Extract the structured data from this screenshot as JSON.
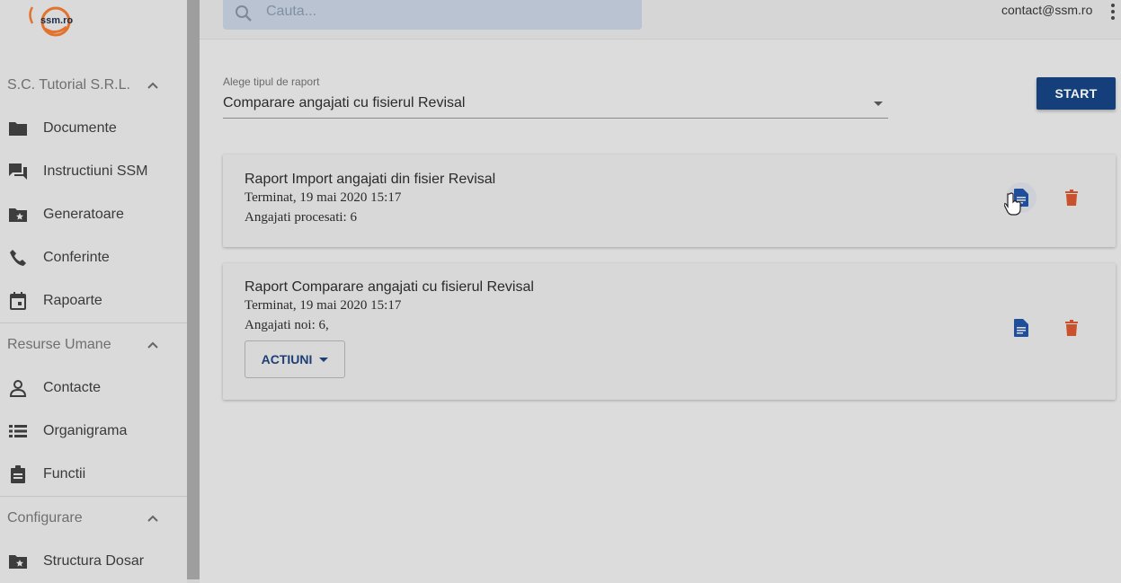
{
  "app": {
    "logo_text": "ssm.ro",
    "brand_color": "#e2722c",
    "accent_color": "#153f7a",
    "delete_color": "#c9522c"
  },
  "sidebar": {
    "sections": [
      {
        "header": "S.C. Tutorial S.R.L.",
        "expanded": true,
        "items": [
          {
            "label": "Documente",
            "icon": "folder-icon"
          },
          {
            "label": "Instructiuni SSM",
            "icon": "forum-icon"
          },
          {
            "label": "Generatoare",
            "icon": "folder-star-icon"
          },
          {
            "label": "Conferinte",
            "icon": "phone-icon"
          },
          {
            "label": "Rapoarte",
            "icon": "calendar-icon"
          }
        ]
      },
      {
        "header": "Resurse Umane",
        "expanded": true,
        "items": [
          {
            "label": "Contacte",
            "icon": "person-icon"
          },
          {
            "label": "Organigrama",
            "icon": "list-icon"
          },
          {
            "label": "Functii",
            "icon": "clipboard-icon"
          }
        ]
      },
      {
        "header": "Configurare",
        "expanded": true,
        "items": [
          {
            "label": "Structura Dosar",
            "icon": "folder-star-icon"
          }
        ]
      }
    ]
  },
  "topbar": {
    "search_placeholder": "Cauta...",
    "user_email": "contact@ssm.ro"
  },
  "report_form": {
    "label": "Alege tipul de raport",
    "selected": "Comparare angajati cu fisierul Revisal",
    "start_label": "START"
  },
  "reports": [
    {
      "title": "Raport Import angajati din fisier Revisal",
      "status": "Terminat, 19 mai 2020 15:17",
      "detail": "Angajati procesati: 6"
    },
    {
      "title": "Raport Comparare angajati cu fisierul Revisal",
      "status": "Terminat, 19 mai 2020 15:17",
      "detail": "Angajati noi: 6,",
      "actions_label": "ACTIUNI"
    }
  ]
}
